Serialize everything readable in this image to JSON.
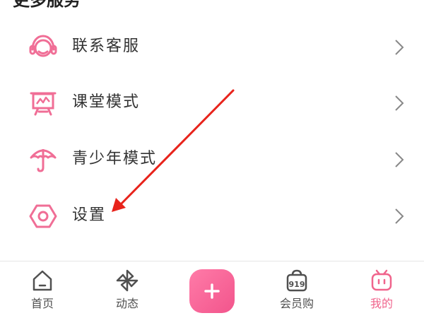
{
  "section": {
    "title": "更多服务"
  },
  "menu": {
    "items": [
      {
        "label": "联系客服",
        "icon": "headset-icon"
      },
      {
        "label": "课堂模式",
        "icon": "classroom-icon"
      },
      {
        "label": "青少年模式",
        "icon": "umbrella-icon"
      },
      {
        "label": "设置",
        "icon": "settings-icon"
      }
    ]
  },
  "tabbar": {
    "items": [
      {
        "label": "首页",
        "icon": "home-icon"
      },
      {
        "label": "动态",
        "icon": "pinwheel-icon"
      },
      {
        "label": "",
        "icon": "plus-icon"
      },
      {
        "label": "会员购",
        "icon": "shopping-bag-icon"
      },
      {
        "label": "我的",
        "icon": "tv-mascot-icon",
        "active": true
      }
    ]
  },
  "colors": {
    "accent": "#f0648c",
    "icon_pink": "#f06e96",
    "annotation_arrow": "#e8231b",
    "tab_icon_gray": "#505050"
  }
}
